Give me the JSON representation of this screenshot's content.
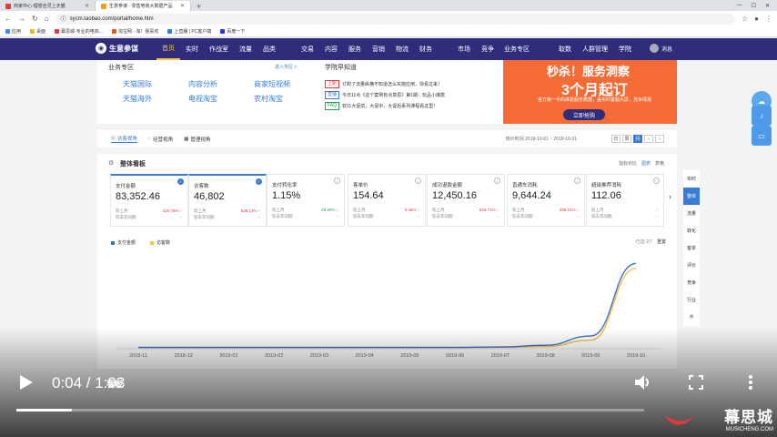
{
  "browser": {
    "tabs": [
      {
        "title": "商家中心-理想全灵上天猫",
        "active": false
      },
      {
        "title": "生意参谋 - 零售电商大数据产品",
        "active": true
      }
    ],
    "url": "sycm.taobao.com/portal/home.htm",
    "bookmarks": [
      "应用",
      "桌面",
      "幕思城-专业的电商...",
      "淘宝网 - 淘！我喜欢",
      "上直播 | PC客户端",
      "百度一下"
    ]
  },
  "topnav": {
    "logo": "生意参谋",
    "items": [
      "首页",
      "实时",
      "作战室",
      "流量",
      "品类",
      "交易",
      "内容",
      "服务",
      "营销",
      "物流",
      "财务",
      "市场",
      "竞争"
    ],
    "active": "首页",
    "right_items": [
      "业务专区",
      "取数",
      "人群管理",
      "学院"
    ],
    "user": "消息"
  },
  "business_zone": {
    "title": "业务专区",
    "enter": "进入专区 >",
    "links": [
      "天猫国际",
      "内容分析",
      "商家短视频",
      "天猫海外",
      "电视淘宝",
      "农村淘宝"
    ]
  },
  "academy": {
    "title": "学院早知道",
    "news": [
      {
        "tag": "上新",
        "text": "订购了流量纵横不知道怎么实施应用，快看过来！"
      },
      {
        "tag": "直播",
        "text": "今日11点《这个案例有点意思》第1期：玩品小爆款"
      },
      {
        "tag": "FAQ",
        "text": "双11大促前，大促中，大促后系列课程看这里！"
      }
    ]
  },
  "promo": {
    "headline": "秒杀！服务洞察",
    "subheadline": "3个月起订",
    "sub": "官方第一手的体验服务数据，盖实时客服大屏，竞争情报",
    "button": "立即抢购"
  },
  "filterbar": {
    "tabs": [
      "访客视角",
      "经营视角",
      "管理视角"
    ],
    "active": "访客视角",
    "date_label": "统计时间 2019-10-01 ~ 2019-10-31",
    "periods": [
      "日",
      "周",
      "月"
    ],
    "active_period": "月"
  },
  "overview": {
    "title": "整体看板",
    "right_links": [
      "指标对比",
      "图表",
      "表格"
    ],
    "metrics": [
      {
        "name": "支付金额",
        "value": "83,352.46",
        "pct": "420.76%",
        "dir": "up",
        "cmp1": "较上月",
        "cmp2": "较去年同期",
        "selected": true
      },
      {
        "name": "访客数",
        "value": "46,802",
        "pct": "639.13%",
        "dir": "up",
        "cmp1": "较上月",
        "cmp2": "较去年同期",
        "selected": true
      },
      {
        "name": "支付转化率",
        "value": "1.15%",
        "pct": "29.60%",
        "dir": "down",
        "cmp1": "较上月",
        "cmp2": "较去年同期",
        "selected": false
      },
      {
        "name": "客单价",
        "value": "154.64",
        "pct": "0.46%",
        "dir": "up",
        "cmp1": "较上月",
        "cmp2": "较去年同期",
        "selected": false
      },
      {
        "name": "成功退款金额",
        "value": "12,450.16",
        "pct": "533.71%",
        "dir": "up",
        "cmp1": "较上月",
        "cmp2": "较去年同期",
        "selected": false
      },
      {
        "name": "直通车消耗",
        "value": "9,644.24",
        "pct": "438.31%",
        "dir": "up",
        "cmp1": "较上月",
        "cmp2": "较去年同期",
        "selected": false
      },
      {
        "name": "超级推荐消耗",
        "value": "112.06",
        "pct": "-",
        "dir": "none",
        "cmp1": "较上月",
        "cmp2": "较去年同期",
        "selected": false
      }
    ],
    "chart_tools": [
      "已选 2/7",
      "重置"
    ]
  },
  "chart_data": {
    "type": "line",
    "x": [
      "2018-11",
      "2018-12",
      "2019-01",
      "2019-02",
      "2019-03",
      "2019-04",
      "2019-05",
      "2019-06",
      "2019-07",
      "2019-08",
      "2019-09",
      "2019-10"
    ],
    "series": [
      {
        "name": "支付金额",
        "color": "#3a6fd5",
        "values": [
          0.5,
          0.5,
          0.5,
          0.5,
          0.5,
          0.5,
          0.5,
          0.5,
          1,
          3,
          14,
          100
        ]
      },
      {
        "name": "访客数",
        "color": "#f5c242",
        "values": [
          0.3,
          0.3,
          0.3,
          0.3,
          0.3,
          0.3,
          0.3,
          0.3,
          0.5,
          1.5,
          9,
          94
        ]
      }
    ],
    "ylim": [
      0,
      108
    ]
  },
  "rightrail": {
    "items": [
      "实时",
      "整体",
      "流量",
      "转化",
      "客单",
      "评价",
      "竞争",
      "行业",
      "不"
    ],
    "active": "整体"
  },
  "player": {
    "time": "0:04 / 1:03",
    "progress": 0.088
  },
  "watermark": {
    "cn": "幕思城",
    "en": "MUSICHENG.COM"
  },
  "lower_title": "看板"
}
